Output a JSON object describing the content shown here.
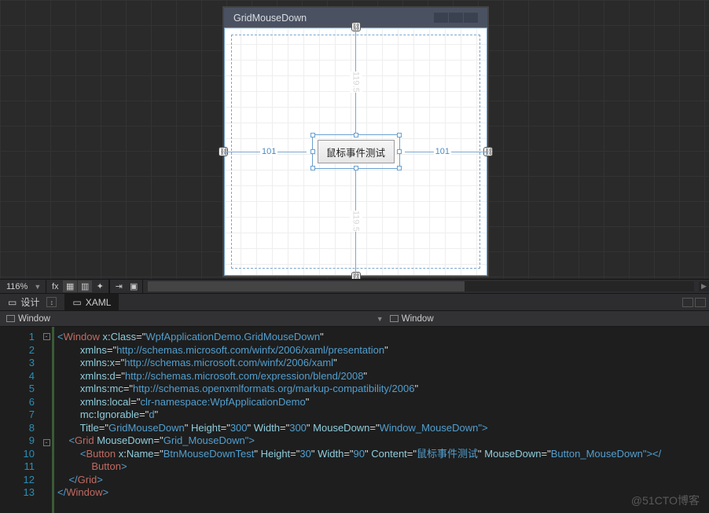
{
  "designer": {
    "window_title": "GridMouseDown",
    "button_content": "鼠标事件测试",
    "margins": {
      "top": "119.5",
      "bottom": "119.5",
      "left": "101",
      "right": "101"
    }
  },
  "toolbar": {
    "zoom": "116%",
    "fx_label": "fx"
  },
  "tabs": {
    "design": "设计",
    "xaml": "XAML"
  },
  "breadcrumb": {
    "left": "Window",
    "right": "Window"
  },
  "code": {
    "lines": [
      "1",
      "2",
      "3",
      "4",
      "5",
      "6",
      "7",
      "8",
      "9",
      "10",
      "11",
      "12",
      "13"
    ],
    "l1_a": "<",
    "l1_b": "Window ",
    "l1_c": "x",
    "l1_d": ":",
    "l1_e": "Class",
    "l1_f": "=\"",
    "l1_g": "WpfApplicationDemo.GridMouseDown",
    "l1_h": "\"",
    "l2_a": "xmlns",
    "l2_b": "=\"",
    "l2_c": "http://schemas.microsoft.com/winfx/2006/xaml/presentation",
    "l2_d": "\"",
    "l3_a": "xmlns",
    "l3_b": ":",
    "l3_c": "x",
    "l3_d": "=\"",
    "l3_e": "http://schemas.microsoft.com/winfx/2006/xaml",
    "l3_f": "\"",
    "l4_a": "xmlns",
    "l4_b": ":",
    "l4_c": "d",
    "l4_d": "=\"",
    "l4_e": "http://schemas.microsoft.com/expression/blend/2008",
    "l4_f": "\"",
    "l5_a": "xmlns",
    "l5_b": ":",
    "l5_c": "mc",
    "l5_d": "=\"",
    "l5_e": "http://schemas.openxmlformats.org/markup-compatibility/2006",
    "l5_f": "\"",
    "l6_a": "xmlns",
    "l6_b": ":",
    "l6_c": "local",
    "l6_d": "=\"",
    "l6_e": "clr-namespace:WpfApplicationDemo",
    "l6_f": "\"",
    "l7_a": "mc",
    "l7_b": ":",
    "l7_c": "Ignorable",
    "l7_d": "=\"",
    "l7_e": "d",
    "l7_f": "\"",
    "l8_a": "Title",
    "l8_b": "=\"",
    "l8_c": "GridMouseDown",
    "l8_d": "\" ",
    "l8_e": "Height",
    "l8_f": "=\"",
    "l8_g": "300",
    "l8_h": "\" ",
    "l8_i": "Width",
    "l8_j": "=\"",
    "l8_k": "300",
    "l8_l": "\" ",
    "l8_m": "MouseDown",
    "l8_n": "=\"",
    "l8_o": "Window_MouseDown",
    "l8_p": "\">",
    "l9_a": "<",
    "l9_b": "Grid ",
    "l9_c": "MouseDown",
    "l9_d": "=\"",
    "l9_e": "Grid_MouseDown",
    "l9_f": "\">",
    "l10_a": "<",
    "l10_b": "Button ",
    "l10_c": "x",
    "l10_d": ":",
    "l10_e": "Name",
    "l10_f": "=\"",
    "l10_g": "BtnMouseDownTest",
    "l10_h": "\" ",
    "l10_i": "Height",
    "l10_j": "=\"",
    "l10_k": "30",
    "l10_l": "\" ",
    "l10_m": "Width",
    "l10_n": "=\"",
    "l10_o": "90",
    "l10_p": "\" ",
    "l10_q": "Content",
    "l10_r": "=\"",
    "l10_s": "鼠标事件测试",
    "l10_t": "\" ",
    "l10_u": "MouseDown",
    "l10_v": "=\"",
    "l10_w": "Button_MouseDown",
    "l10_x": "\"></",
    "l10_y": "Button",
    "l10_z": ">",
    "l11_a": "</",
    "l11_b": "Grid",
    "l11_c": ">",
    "l12_a": "</",
    "l12_b": "Window",
    "l12_c": ">"
  },
  "watermark": "@51CTO博客"
}
